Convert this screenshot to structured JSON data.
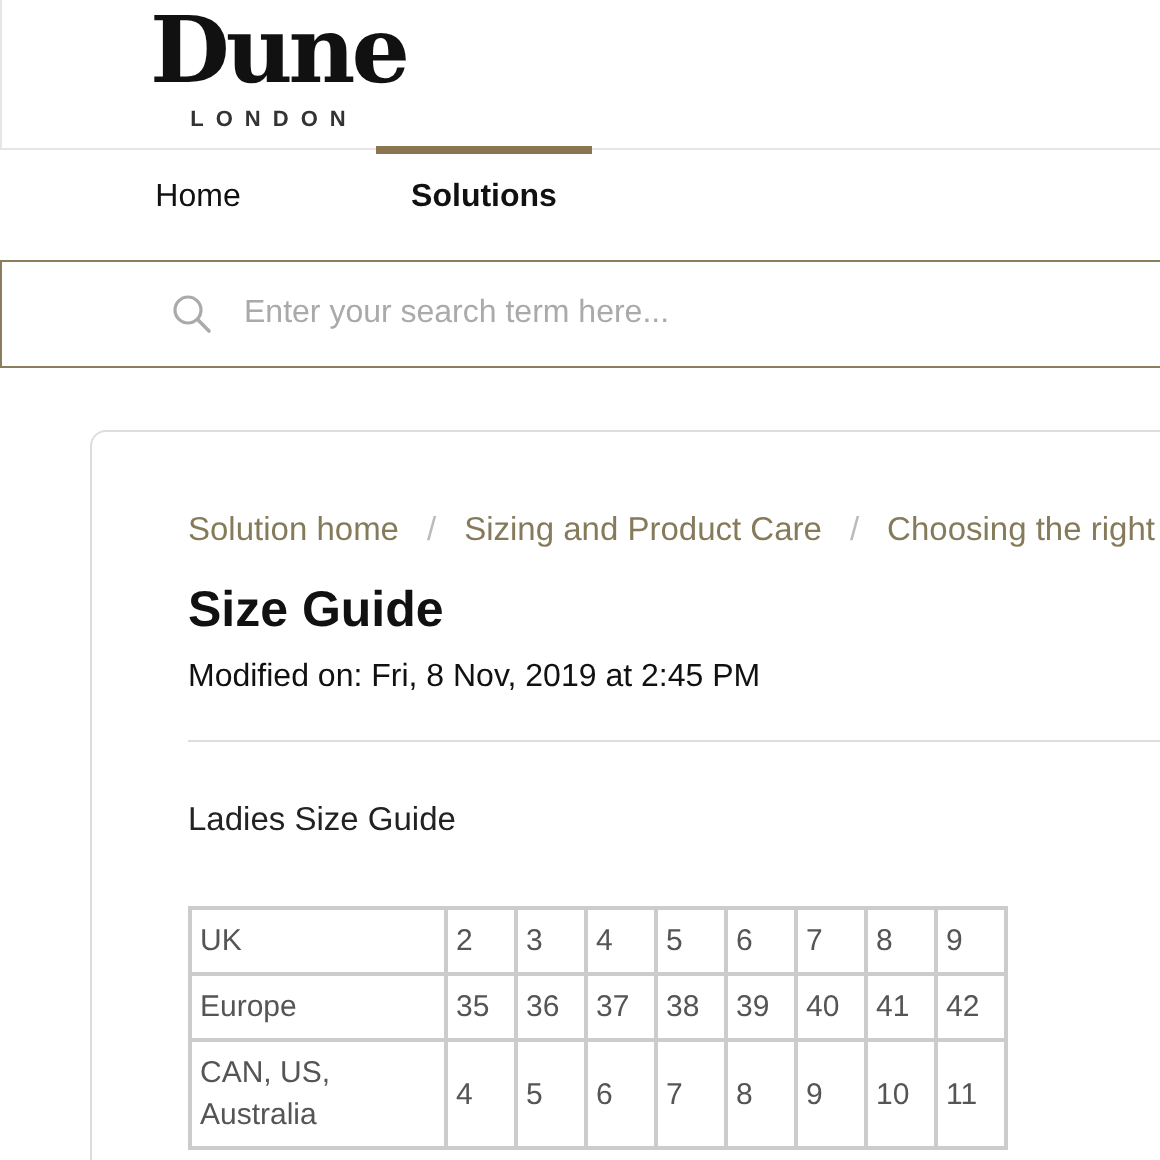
{
  "logo": {
    "name": "Dune",
    "tagline": "LONDON"
  },
  "tabs": [
    {
      "label": "Home",
      "selected": false
    },
    {
      "label": "Solutions",
      "selected": true
    }
  ],
  "search": {
    "placeholder": "Enter your search term here..."
  },
  "breadcrumb": {
    "separator": "/",
    "items": [
      "Solution home",
      "Sizing and Product Care",
      "Choosing the right"
    ]
  },
  "article": {
    "title": "Size Guide",
    "modified": "Modified on: Fri, 8 Nov, 2019 at 2:45 PM",
    "subtitle": "Ladies Size Guide"
  },
  "table": {
    "rows": [
      [
        "UK",
        "2",
        "3",
        "4",
        "5",
        "6",
        "7",
        "8",
        "9"
      ],
      [
        "Europe",
        "35",
        "36",
        "37",
        "38",
        "39",
        "40",
        "41",
        "42"
      ],
      [
        "CAN, US, Australia",
        "4",
        "5",
        "6",
        "7",
        "8",
        "9",
        "10",
        "11"
      ]
    ]
  }
}
